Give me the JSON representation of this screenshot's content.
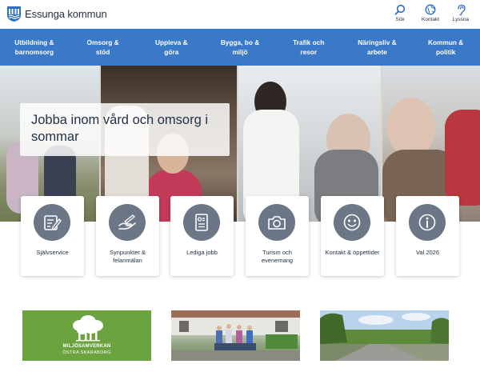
{
  "header": {
    "logo_text": "Essunga kommun",
    "tools": [
      {
        "label": "Sök",
        "icon": "search-icon"
      },
      {
        "label": "Kontakt",
        "icon": "globe-icon"
      },
      {
        "label": "Lyssna",
        "icon": "ear-icon"
      }
    ]
  },
  "nav": {
    "items": [
      {
        "label": "Utbildning &\nbarnomsorg"
      },
      {
        "label": "Omsorg &\nstöd"
      },
      {
        "label": "Uppleva &\ngöra"
      },
      {
        "label": "Bygga, bo &\nmiljö"
      },
      {
        "label": "Trafik och\nresor"
      },
      {
        "label": "Näringsliv &\narbete"
      },
      {
        "label": "Kommun &\npolitik"
      }
    ]
  },
  "hero": {
    "title": "Jobba inom vård och omsorg i sommar"
  },
  "quick_links": [
    {
      "label": "Självservice",
      "icon": "form-icon"
    },
    {
      "label": "Synpunkter & felanmälan",
      "icon": "hand-pen-icon"
    },
    {
      "label": "Lediga jobb",
      "icon": "resume-icon"
    },
    {
      "label": "Turism och evenemang",
      "icon": "camera-icon"
    },
    {
      "label": "Kontakt & öppettider",
      "icon": "smiley-icon"
    },
    {
      "label": "Val 2026",
      "icon": "info-icon"
    }
  ],
  "tiles": {
    "miljo": {
      "line1": "MILJÖSAMVERKAN",
      "line2": "ÖSTRA SKARABORG"
    }
  },
  "colors": {
    "nav_bg": "#3a78c8",
    "icon_circle": "#6b7686",
    "miljo_green": "#6ca341"
  }
}
